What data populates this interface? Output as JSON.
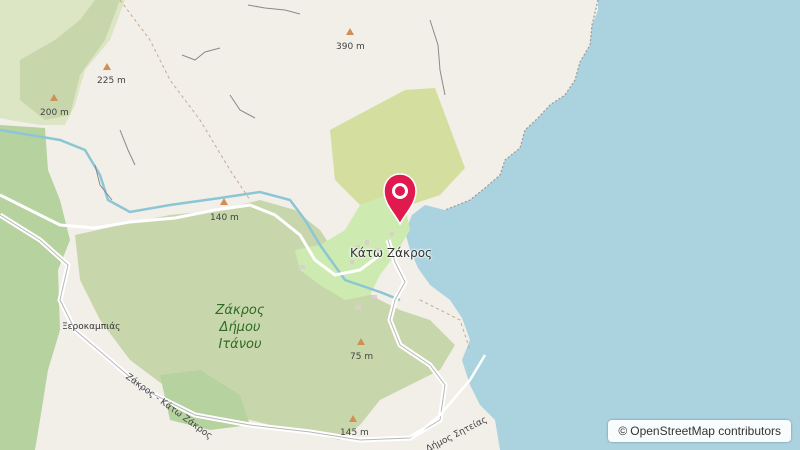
{
  "map": {
    "place_label": "Κάτω Ζάκρος",
    "area_name_lines": [
      "Ζάκρος",
      "Δήμου",
      "Ιτάνου"
    ],
    "village_label": "Ξεροκαμπιάς",
    "road_label_left": "Ζάκρος - Κάτω Ζάκρος",
    "road_label_right": "Δήμος Σητείας",
    "elevations": {
      "e1": "390 m",
      "e2": "225 m",
      "e3": "200 m",
      "e4": "140 m",
      "e5": "75 m",
      "e6": "145 m"
    }
  },
  "attribution": {
    "symbol": "©",
    "text": "OpenStreetMap contributors"
  },
  "colors": {
    "sea": "#aad3df",
    "land": "#f2efe9",
    "forest": "#c8d7ab",
    "green_area": "#cdebb0",
    "marker": "#e0194e"
  }
}
